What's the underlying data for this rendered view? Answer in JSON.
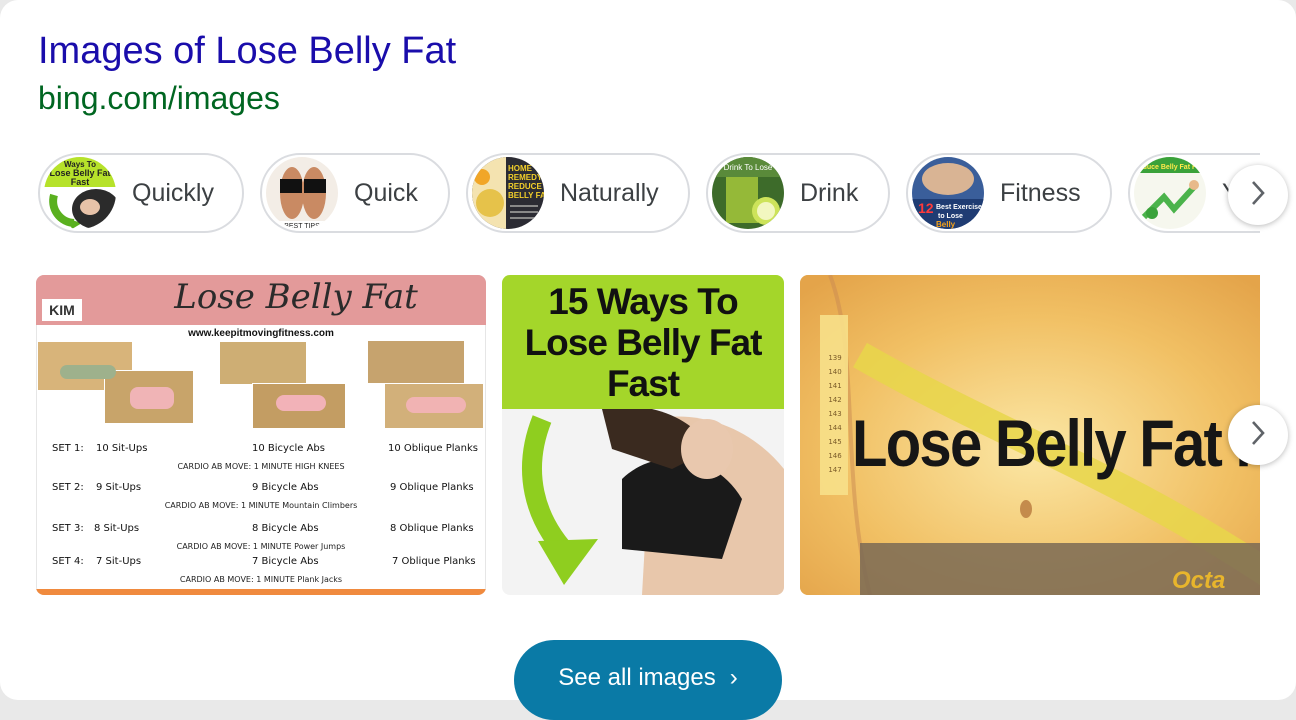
{
  "header": {
    "title": "Images of Lose Belly Fat",
    "source": "bing.com/images"
  },
  "chips": [
    {
      "label": "Quickly",
      "thumb_text": "Ways to Lose Belly Fat Fast"
    },
    {
      "label": "Quick",
      "thumb_text": "BEST TIPS"
    },
    {
      "label": "Naturally",
      "thumb_text": "HOME REMEDY TO REDUCE BELLY FAT"
    },
    {
      "label": "Drink",
      "thumb_text": "Drink To Lose"
    },
    {
      "label": "Fitness",
      "thumb_text": "Best Exercises to Lose Belly"
    },
    {
      "label": "Y",
      "thumb_text": "Reduce Belly Fat Fast"
    }
  ],
  "images": {
    "img1": {
      "title": "Lose Belly Fat",
      "logo": "KIM",
      "site": "www.keepitmovingfitness.com",
      "rows": [
        {
          "set": "SET 1:",
          "a": "10 Sit-Ups",
          "b": "10 Bicycle Abs",
          "c": "10 Oblique Planks",
          "cardio": "CARDIO AB MOVE: 1 MINUTE  HIGH KNEES"
        },
        {
          "set": "SET 2:",
          "a": "9 Sit-Ups",
          "b": "9 Bicycle Abs",
          "c": "9 Oblique Planks",
          "cardio": "CARDIO AB MOVE: 1 MINUTE  Mountain Climbers"
        },
        {
          "set": "SET 3:",
          "a": "8 Sit-Ups",
          "b": "8 Bicycle Abs",
          "c": "8 Oblique Planks",
          "cardio": "CARDIO AB MOVE: 1 MINUTE  Power Jumps"
        },
        {
          "set": "SET 4:",
          "a": "7 Sit-Ups",
          "b": "7 Bicycle Abs",
          "c": "7 Oblique Planks",
          "cardio": "CARDIO AB MOVE: 1 MINUTE  Plank Jacks"
        }
      ]
    },
    "img2": {
      "line1": "15 Ways To",
      "line2": "Lose Belly Fat",
      "line3": "Fast"
    },
    "img3": {
      "text": "Lose Belly Fat Fa",
      "corner": "Octa",
      "tape_marks": [
        "139",
        "140",
        "141",
        "142",
        "143",
        "144",
        "145",
        "146",
        "147"
      ]
    }
  },
  "see_all": {
    "label": "See all images",
    "arrow": "›"
  },
  "colors": {
    "title": "#1a0dab",
    "url": "#006621",
    "button": "#0a7aa6",
    "green": "#8fce1f"
  }
}
